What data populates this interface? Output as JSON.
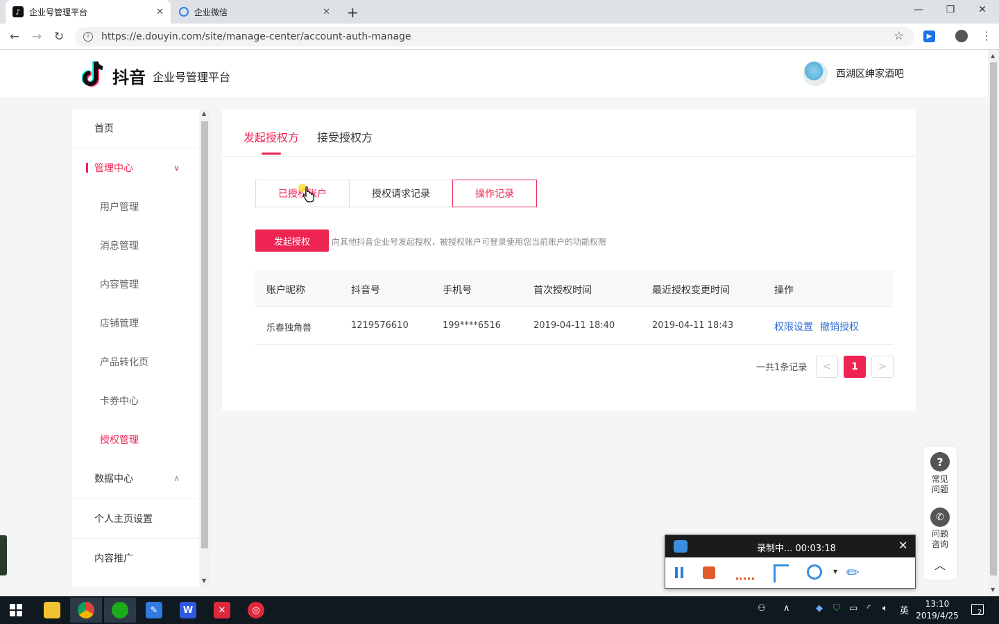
{
  "browser": {
    "tabs": [
      {
        "title": "企业号管理平台",
        "active": true
      },
      {
        "title": "企业微信",
        "active": false
      }
    ],
    "url": "https://e.douyin.com/site/manage-center/account-auth-manage"
  },
  "header": {
    "logo_text": "抖音",
    "platform": "企业号管理平台",
    "username": "西湖区绅家酒吧"
  },
  "sidebar": {
    "items": [
      {
        "label": "首页"
      },
      {
        "label": "管理中心"
      },
      {
        "label": "用户管理"
      },
      {
        "label": "消息管理"
      },
      {
        "label": "内容管理"
      },
      {
        "label": "店铺管理"
      },
      {
        "label": "产品转化页"
      },
      {
        "label": "卡券中心"
      },
      {
        "label": "授权管理"
      },
      {
        "label": "数据中心"
      },
      {
        "label": "个人主页设置"
      },
      {
        "label": "内容推广"
      }
    ]
  },
  "main": {
    "tabs": [
      "发起授权方",
      "接受授权方"
    ],
    "segments": [
      "已授权账户",
      "授权请求记录",
      "操作记录"
    ],
    "initiate_button": "发起授权",
    "hint": "向其他抖音企业号发起授权，被授权账户可登录使用您当前账户的功能权限",
    "table": {
      "headers": [
        "账户昵称",
        "抖音号",
        "手机号",
        "首次授权时间",
        "最近授权变更时间",
        "操作"
      ],
      "rows": [
        {
          "nickname": "乐春独角兽",
          "douyin_id": "1219576610",
          "phone": "199****6516",
          "first_auth": "2019-04-11 18:40",
          "last_change": "2019-04-11 18:43",
          "action_settings": "权限设置",
          "action_revoke": "撤销授权"
        }
      ]
    },
    "pagination": {
      "total": "一共1条记录",
      "current": "1",
      "prev": "<",
      "next": ">"
    }
  },
  "help": {
    "faq": "常见\n问题",
    "consult": "问题\n咨询"
  },
  "recorder": {
    "title": "录制中... 00:03:18"
  },
  "taskbar": {
    "ime": "英",
    "time": "13:10",
    "date": "2019/4/25",
    "notifications": "2"
  },
  "colors": {
    "accent": "#ee2453",
    "link": "#2f6fd6"
  }
}
